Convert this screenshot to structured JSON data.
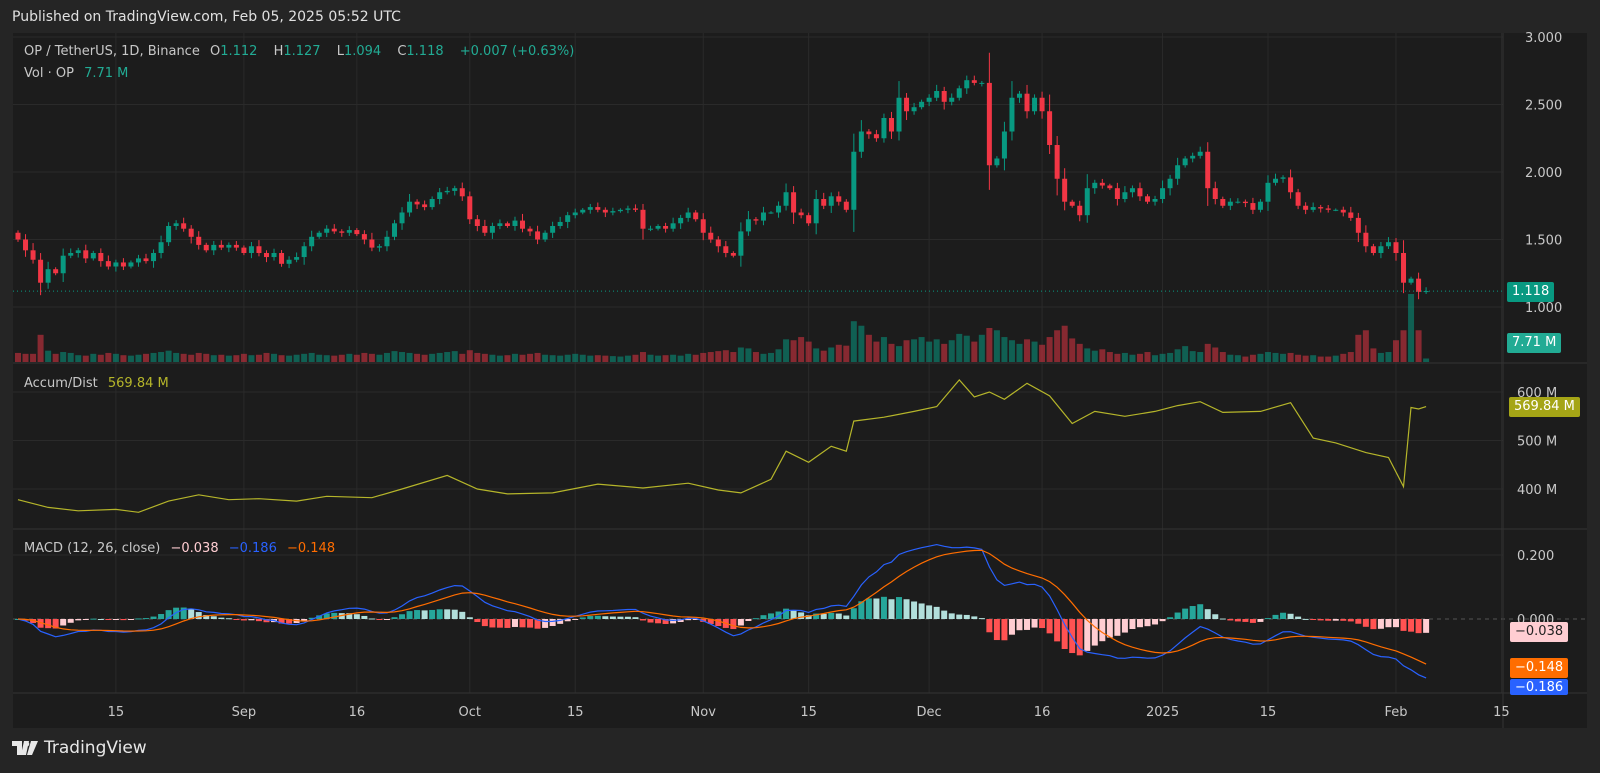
{
  "published": "Published on TradingView.com, Feb 05, 2025 05:52 UTC",
  "header": {
    "symbol": "OP / TetherUS, 1D, Binance",
    "o_label": "O",
    "o": "1.112",
    "h_label": "H",
    "h": "1.127",
    "l_label": "L",
    "l": "1.094",
    "c_label": "C",
    "c": "1.118",
    "change": "+0.007 (+0.63%)",
    "vol_label": "Vol · OP",
    "vol": "7.71 M"
  },
  "accum": {
    "label": "Accum/Dist",
    "value": "569.84 M"
  },
  "macd": {
    "label": "MACD (12, 26, close)",
    "hist": "−0.038",
    "macd": "−0.186",
    "signal": "−0.148"
  },
  "price_tag": "1.118",
  "vol_tag": "7.71 M",
  "accum_tag": "569.84 M",
  "macd_tags": {
    "hist": "−0.038",
    "signal": "−0.148",
    "macd": "−0.186"
  },
  "footer": {
    "brand": "TradingView"
  },
  "colors": {
    "up": "#089981",
    "down": "#f23645",
    "accum": "#b5b52a",
    "macd": "#2962ff",
    "signal": "#ff6d00",
    "hist_up": "#26a69a",
    "hist_up_fade": "#b2dfdb",
    "hist_down": "#ff5252",
    "hist_down_fade": "#ffcdd2"
  },
  "chart_data": [
    {
      "type": "candlestick",
      "title": "OP / TetherUS, 1D, Binance",
      "start_date": "2024-08-02",
      "interval": "1D",
      "ylim": [
        1.0,
        3.0
      ],
      "yticks": [
        "3.000",
        "2.500",
        "2.000",
        "1.500",
        "1.000"
      ],
      "ytick_values": [
        3.0,
        2.5,
        2.0,
        1.5,
        1.0
      ],
      "xticks": [
        {
          "date": "2024-08-15",
          "label": "15"
        },
        {
          "date": "2024-09-01",
          "label": "Sep"
        },
        {
          "date": "2024-09-16",
          "label": "16"
        },
        {
          "date": "2024-10-01",
          "label": "Oct"
        },
        {
          "date": "2024-10-15",
          "label": "15"
        },
        {
          "date": "2024-11-01",
          "label": "Nov"
        },
        {
          "date": "2024-11-15",
          "label": "15"
        },
        {
          "date": "2024-12-01",
          "label": "Dec"
        },
        {
          "date": "2024-12-16",
          "label": "16"
        },
        {
          "date": "2025-01-01",
          "label": "2025"
        },
        {
          "date": "2025-01-15",
          "label": "15"
        },
        {
          "date": "2025-02-01",
          "label": "Feb"
        },
        {
          "date": "2025-02-15",
          "label": "15"
        }
      ],
      "first_open": 1.55,
      "close": [
        1.5,
        1.42,
        1.35,
        1.18,
        1.28,
        1.25,
        1.38,
        1.4,
        1.42,
        1.36,
        1.4,
        1.34,
        1.3,
        1.33,
        1.3,
        1.33,
        1.36,
        1.34,
        1.4,
        1.48,
        1.6,
        1.62,
        1.58,
        1.52,
        1.46,
        1.42,
        1.46,
        1.44,
        1.46,
        1.44,
        1.4,
        1.45,
        1.4,
        1.37,
        1.4,
        1.32,
        1.35,
        1.37,
        1.45,
        1.52,
        1.55,
        1.58,
        1.56,
        1.55,
        1.57,
        1.54,
        1.5,
        1.44,
        1.45,
        1.52,
        1.62,
        1.7,
        1.78,
        1.76,
        1.74,
        1.8,
        1.85,
        1.86,
        1.88,
        1.82,
        1.65,
        1.6,
        1.55,
        1.6,
        1.62,
        1.6,
        1.64,
        1.58,
        1.56,
        1.5,
        1.55,
        1.6,
        1.63,
        1.68,
        1.7,
        1.72,
        1.74,
        1.72,
        1.7,
        1.71,
        1.72,
        1.73,
        1.72,
        1.58,
        1.58,
        1.6,
        1.58,
        1.62,
        1.66,
        1.7,
        1.65,
        1.55,
        1.5,
        1.45,
        1.4,
        1.38,
        1.56,
        1.65,
        1.64,
        1.7,
        1.7,
        1.75,
        1.85,
        1.7,
        1.68,
        1.62,
        1.8,
        1.75,
        1.82,
        1.78,
        1.72,
        2.15,
        2.3,
        2.28,
        2.25,
        2.4,
        2.3,
        2.55,
        2.45,
        2.48,
        2.52,
        2.55,
        2.6,
        2.52,
        2.55,
        2.62,
        2.68,
        2.66,
        2.66,
        2.05,
        2.1,
        2.3,
        2.55,
        2.58,
        2.45,
        2.55,
        2.45,
        2.2,
        1.95,
        1.78,
        1.75,
        1.68,
        1.88,
        1.92,
        1.9,
        1.88,
        1.8,
        1.85,
        1.88,
        1.82,
        1.78,
        1.8,
        1.88,
        1.95,
        2.05,
        2.1,
        2.12,
        2.15,
        1.88,
        1.8,
        1.75,
        1.78,
        1.78,
        1.77,
        1.72,
        1.78,
        1.92,
        1.95,
        1.96,
        1.85,
        1.75,
        1.72,
        1.74,
        1.73,
        1.72,
        1.72,
        1.7,
        1.66,
        1.55,
        1.45,
        1.4,
        1.45,
        1.48,
        1.4,
        1.18,
        1.21,
        1.112,
        1.118
      ]
    },
    {
      "type": "bar",
      "name": "Vol · OP",
      "unit": "M",
      "values": [
        20,
        18,
        18,
        60,
        25,
        18,
        22,
        20,
        15,
        14,
        18,
        16,
        20,
        18,
        15,
        14,
        16,
        18,
        20,
        22,
        25,
        20,
        18,
        16,
        20,
        18,
        15,
        16,
        14,
        15,
        18,
        15,
        16,
        20,
        18,
        15,
        14,
        16,
        18,
        20,
        16,
        15,
        14,
        16,
        18,
        16,
        20,
        18,
        16,
        20,
        24,
        22,
        20,
        18,
        16,
        18,
        20,
        22,
        24,
        18,
        26,
        20,
        18,
        16,
        14,
        15,
        18,
        16,
        18,
        20,
        16,
        15,
        14,
        16,
        18,
        16,
        14,
        15,
        14,
        13,
        12,
        14,
        16,
        22,
        16,
        14,
        15,
        16,
        14,
        18,
        16,
        20,
        22,
        24,
        26,
        22,
        32,
        30,
        22,
        18,
        20,
        28,
        50,
        48,
        55,
        45,
        30,
        25,
        32,
        38,
        36,
        90,
        80,
        60,
        45,
        55,
        40,
        35,
        48,
        50,
        55,
        45,
        50,
        40,
        48,
        62,
        58,
        45,
        60,
        75,
        70,
        55,
        48,
        40,
        50,
        45,
        38,
        55,
        70,
        80,
        52,
        40,
        30,
        25,
        28,
        22,
        18,
        20,
        16,
        18,
        22,
        15,
        18,
        20,
        28,
        35,
        24,
        22,
        40,
        32,
        22,
        16,
        15,
        12,
        16,
        18,
        22,
        20,
        18,
        20,
        16,
        14,
        15,
        12,
        12,
        14,
        18,
        22,
        60,
        70,
        30,
        20,
        22,
        48,
        70,
        150,
        70,
        7.71
      ]
    },
    {
      "type": "line",
      "name": "Accum/Dist",
      "unit": "M",
      "yticks": [
        "600 M",
        "500 M",
        "400 M"
      ],
      "ytick_values": [
        600,
        500,
        400
      ],
      "points": [
        [
          "2024-08-02",
          378
        ],
        [
          "2024-08-06",
          362
        ],
        [
          "2024-08-10",
          355
        ],
        [
          "2024-08-15",
          358
        ],
        [
          "2024-08-18",
          352
        ],
        [
          "2024-08-22",
          375
        ],
        [
          "2024-08-26",
          388
        ],
        [
          "2024-08-30",
          378
        ],
        [
          "2024-09-03",
          380
        ],
        [
          "2024-09-08",
          375
        ],
        [
          "2024-09-12",
          385
        ],
        [
          "2024-09-18",
          382
        ],
        [
          "2024-09-22",
          400
        ],
        [
          "2024-09-28",
          428
        ],
        [
          "2024-10-02",
          400
        ],
        [
          "2024-10-06",
          390
        ],
        [
          "2024-10-12",
          392
        ],
        [
          "2024-10-18",
          410
        ],
        [
          "2024-10-24",
          402
        ],
        [
          "2024-10-30",
          412
        ],
        [
          "2024-11-03",
          398
        ],
        [
          "2024-11-06",
          392
        ],
        [
          "2024-11-10",
          420
        ],
        [
          "2024-11-12",
          478
        ],
        [
          "2024-11-15",
          455
        ],
        [
          "2024-11-18",
          488
        ],
        [
          "2024-11-20",
          478
        ],
        [
          "2024-11-21",
          540
        ],
        [
          "2024-11-25",
          548
        ],
        [
          "2024-11-29",
          560
        ],
        [
          "2024-12-02",
          570
        ],
        [
          "2024-12-05",
          625
        ],
        [
          "2024-12-07",
          590
        ],
        [
          "2024-12-09",
          600
        ],
        [
          "2024-12-11",
          585
        ],
        [
          "2024-12-14",
          618
        ],
        [
          "2024-12-17",
          592
        ],
        [
          "2024-12-20",
          535
        ],
        [
          "2024-12-23",
          560
        ],
        [
          "2024-12-27",
          550
        ],
        [
          "2024-12-31",
          560
        ],
        [
          "2025-01-03",
          572
        ],
        [
          "2025-01-06",
          580
        ],
        [
          "2025-01-09",
          558
        ],
        [
          "2025-01-14",
          560
        ],
        [
          "2025-01-18",
          578
        ],
        [
          "2025-01-21",
          505
        ],
        [
          "2025-01-24",
          495
        ],
        [
          "2025-01-28",
          475
        ],
        [
          "2025-01-31",
          465
        ],
        [
          "2025-02-02",
          405
        ],
        [
          "2025-02-03",
          568
        ],
        [
          "2025-02-04",
          565
        ],
        [
          "2025-02-05",
          569.84
        ]
      ]
    },
    {
      "type": "macd",
      "name": "MACD (12, 26, close)",
      "params": [
        12,
        26,
        9
      ],
      "yticks": [
        "0.200",
        "0.000"
      ],
      "ytick_values": [
        0.2,
        0.0
      ],
      "last": {
        "histogram": -0.038,
        "macd": -0.186,
        "signal": -0.148
      }
    }
  ]
}
